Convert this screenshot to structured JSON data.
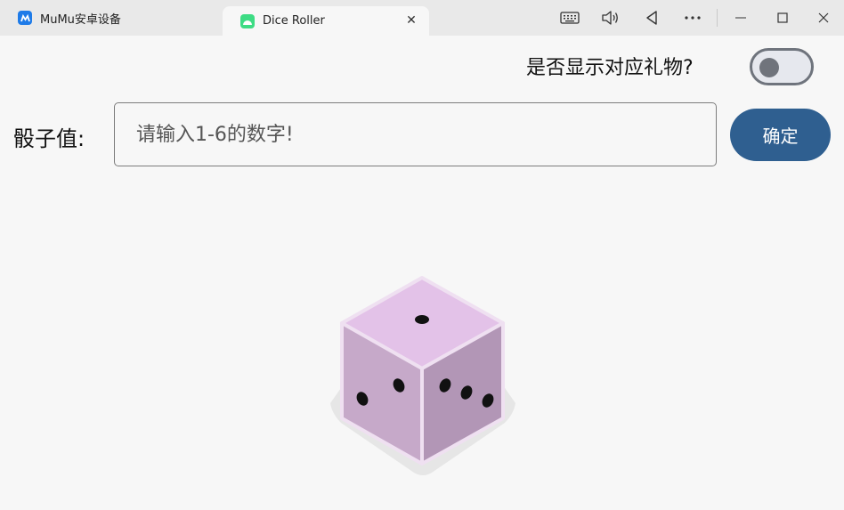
{
  "tabs": [
    {
      "label": "MuMu安卓设备",
      "icon": "mumu-icon"
    },
    {
      "label": "Dice Roller",
      "icon": "android-icon",
      "active": true
    }
  ],
  "toolbar_icons": [
    "keyboard-icon",
    "volume-icon",
    "back-icon",
    "more-icon",
    "minimize-icon",
    "maximize-icon",
    "close-icon"
  ],
  "main": {
    "toggle_label": "是否显示对应礼物?",
    "toggle_on": false,
    "dice_label": "骰子值:",
    "input_placeholder": "请输入1-6的数字!",
    "input_value": "",
    "confirm_label": "确定"
  },
  "colors": {
    "accent": "#2f5f90",
    "dice_top": "#e3c2e8",
    "dice_left": "#c6a9c9",
    "dice_right": "#b296b6"
  }
}
